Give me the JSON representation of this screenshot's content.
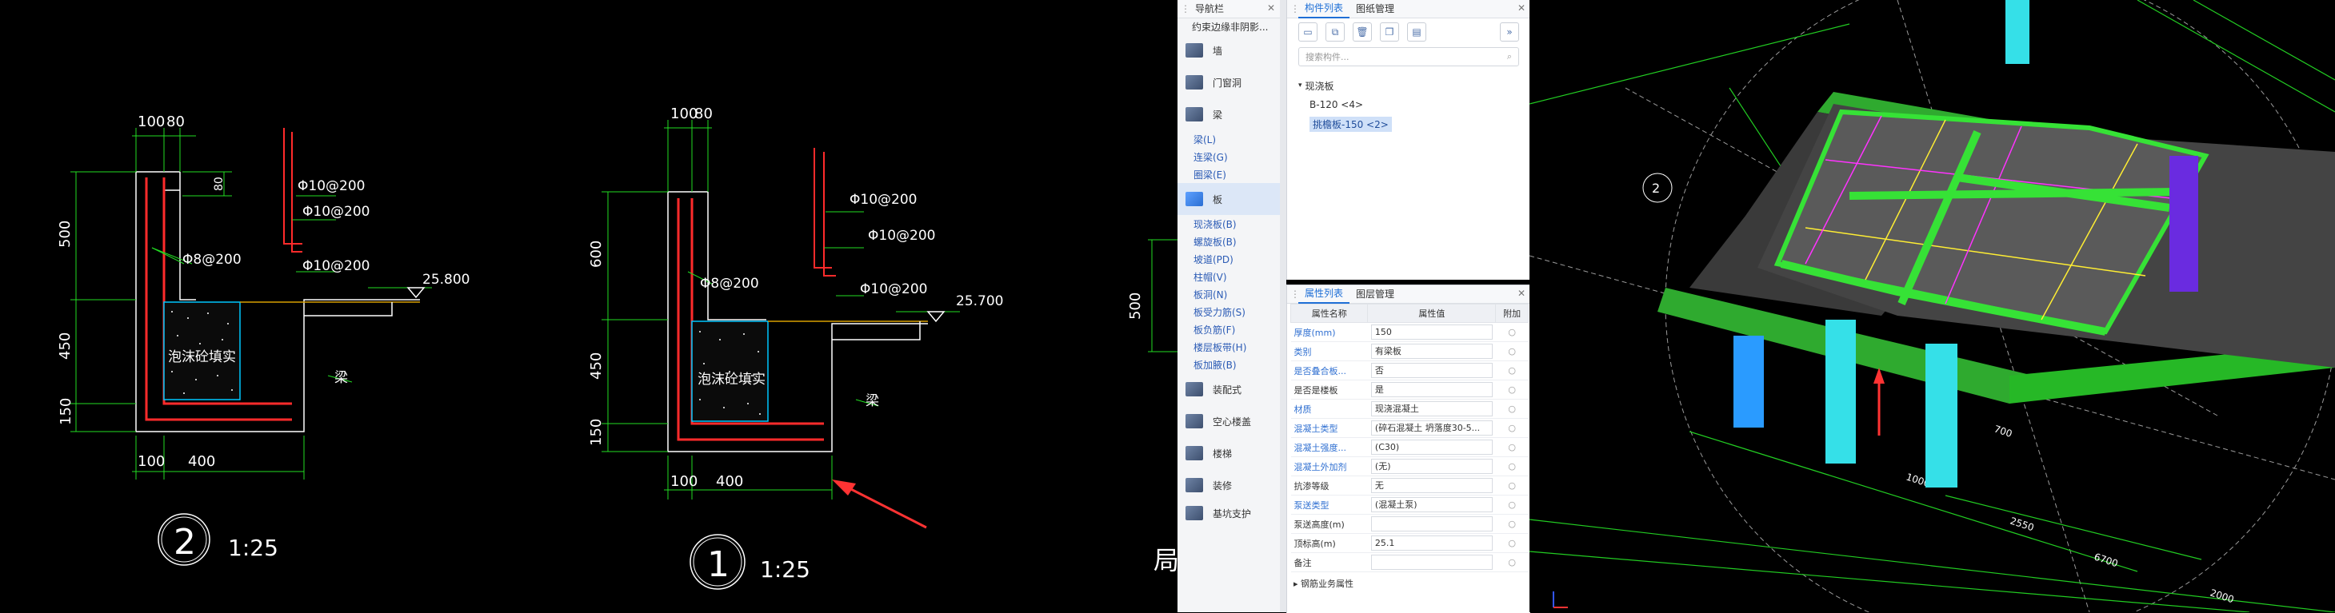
{
  "cad": {
    "left_detail": {
      "dims_top": [
        "100",
        "80"
      ],
      "dim_80": "80",
      "dims_left": [
        "500",
        "450",
        "150"
      ],
      "dims_bottom": [
        "100",
        "400"
      ],
      "rebar1": "Φ10@200",
      "rebar2": "Φ10@200",
      "rebar3": "Φ10@200",
      "rebar4": "Φ8@200",
      "elevation": "25.800",
      "fill_label": "泡沫砼填实",
      "beam_label": "梁",
      "section_no": "2",
      "scale": "1:25"
    },
    "right_detail": {
      "dims_top": [
        "100",
        "80"
      ],
      "dims_left": [
        "600",
        "450",
        "150"
      ],
      "dims_bottom": [
        "100",
        "400"
      ],
      "rebar1": "Φ10@200",
      "rebar2": "Φ10@200",
      "rebar3": "Φ10@200",
      "rebar4": "Φ8@200",
      "elevation": "25.700",
      "fill_label": "泡沫砼填实",
      "beam_label": "梁",
      "section_no": "1",
      "scale": "1:25"
    },
    "partial": {
      "dim": "500",
      "glyph": "局"
    }
  },
  "nav": {
    "title": "导航栏",
    "top_item": "约束边缘非阴影...",
    "big_items": [
      {
        "label": "墙",
        "icon": "wall-icon"
      },
      {
        "label": "门窗洞",
        "icon": "door-window-icon"
      },
      {
        "label": "梁",
        "icon": "beam-icon"
      }
    ],
    "beam_items": [
      "梁(L)",
      "连梁(G)",
      "圈梁(E)"
    ],
    "slab": {
      "label": "板",
      "icon": "slab-icon"
    },
    "slab_items": [
      "现浇板(B)",
      "螺旋板(B)",
      "坡道(PD)",
      "柱帽(V)",
      "板洞(N)",
      "板受力筋(S)",
      "板负筋(F)",
      "楼层板带(H)",
      "板加腋(B)"
    ],
    "bottom_items": [
      {
        "label": "装配式",
        "icon": "prefab-icon"
      },
      {
        "label": "空心楼盖",
        "icon": "hollow-floor-icon"
      },
      {
        "label": "楼梯",
        "icon": "stair-icon"
      },
      {
        "label": "装修",
        "icon": "decoration-icon"
      },
      {
        "label": "基坑支护",
        "icon": "pit-support-icon"
      }
    ]
  },
  "components": {
    "tab_active": "构件列表",
    "tab_other": "图纸管理",
    "search_placeholder": "搜索构件...",
    "tree_root": "现浇板",
    "items": [
      "B-120 <4>",
      "挑檐板-150 <2>"
    ]
  },
  "properties": {
    "tab_active": "属性列表",
    "tab_other": "图层管理",
    "col_name": "属性名称",
    "col_value": "属性值",
    "col_add": "附加",
    "rows": [
      {
        "name": "厚度(mm)",
        "value": "150",
        "link": true
      },
      {
        "name": "类别",
        "value": "有梁板",
        "link": true
      },
      {
        "name": "是否叠合板...",
        "value": "否",
        "link": true
      },
      {
        "name": "是否是楼板",
        "value": "是",
        "link": false
      },
      {
        "name": "材质",
        "value": "现浇混凝土",
        "link": true
      },
      {
        "name": "混凝土类型",
        "value": "(碎石混凝土 坍落度30-5...",
        "link": true
      },
      {
        "name": "混凝土强度...",
        "value": "(C30)",
        "link": true
      },
      {
        "name": "混凝土外加剂",
        "value": "(无)",
        "link": true
      },
      {
        "name": "抗渗等级",
        "value": "无",
        "link": false
      },
      {
        "name": "泵送类型",
        "value": "(混凝土泵)",
        "link": true
      },
      {
        "name": "泵送高度(m)",
        "value": "",
        "link": false
      },
      {
        "name": "顶标高(m)",
        "value": "25.1",
        "link": false
      },
      {
        "name": "备注",
        "value": "",
        "link": false
      }
    ],
    "expander": "钢筋业务属性"
  },
  "view3d": {
    "grid_label": "2",
    "dims": [
      "1000",
      "2550",
      "6700",
      "2000",
      "700"
    ]
  }
}
